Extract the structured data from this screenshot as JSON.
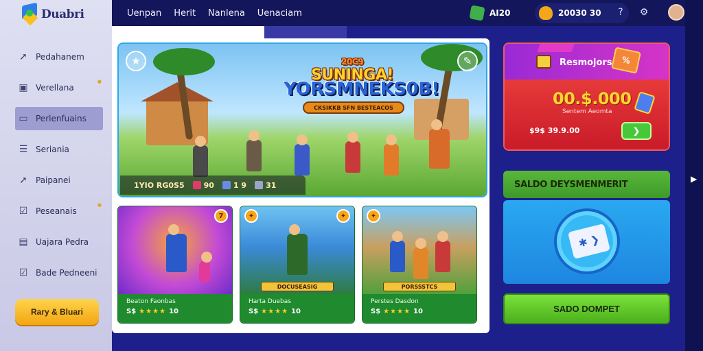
{
  "brand": {
    "name": "Duabri"
  },
  "sidebar": {
    "items": [
      {
        "label": "Pedahanem",
        "icon": "arrow-icon"
      },
      {
        "label": "Verellana",
        "icon": "image-icon"
      },
      {
        "label": "Perlenfuains",
        "icon": "card-icon",
        "active": true
      },
      {
        "label": "Seriania",
        "icon": "list-icon"
      },
      {
        "label": "Paipanei",
        "icon": "arrow-icon"
      },
      {
        "label": "Peseanais",
        "icon": "check-icon"
      },
      {
        "label": "Uajara Pedra",
        "icon": "box-icon"
      },
      {
        "label": "Bade Pedneeni",
        "icon": "check-icon"
      }
    ],
    "cta_label": "Rary & Bluari"
  },
  "header": {
    "nav": [
      "Uenpan",
      "Herit",
      "Nanlena",
      "Uenaciam"
    ],
    "gems_value": "AI20",
    "coins_value": "20030 30"
  },
  "hero": {
    "title_top": "20C9",
    "title_main": "SUNINGA!",
    "title_sub": "YORSMNEKS0B!",
    "banner": "CKSIKKB SFN BESTEACOS",
    "stats": [
      {
        "label": "1YIO RG0S5",
        "color": "#f4a717"
      },
      {
        "label": "90",
        "color": "#e23a6a"
      },
      {
        "label": "1 9",
        "color": "#6a8ae8"
      },
      {
        "label": "31",
        "color": "#9aa4c8"
      }
    ]
  },
  "cards": [
    {
      "title": "Beaton Faonbas",
      "rating_prefix": "S$",
      "stars": "★★★★",
      "score": "10",
      "badge": "7"
    },
    {
      "title": "Harta Duebas",
      "rating_prefix": "S$",
      "stars": "★★★★",
      "score": "10",
      "tag": "DOCUSEASIG"
    },
    {
      "title": "Perstes Dasdon",
      "rating_prefix": "S$",
      "stars": "★★★★",
      "score": "10",
      "tag": "PORSSSTCS"
    }
  ],
  "promo": {
    "label": "Resmojors",
    "amount": "00.$.000",
    "sub": "Sentem Aeomta",
    "line": "$9$ 39.9.00",
    "go_label": "❯"
  },
  "sado": {
    "header": "SALDO DEYSMENMERIT",
    "card_glyph": "✱ ❯",
    "button_label": "SADO DOMPET"
  }
}
